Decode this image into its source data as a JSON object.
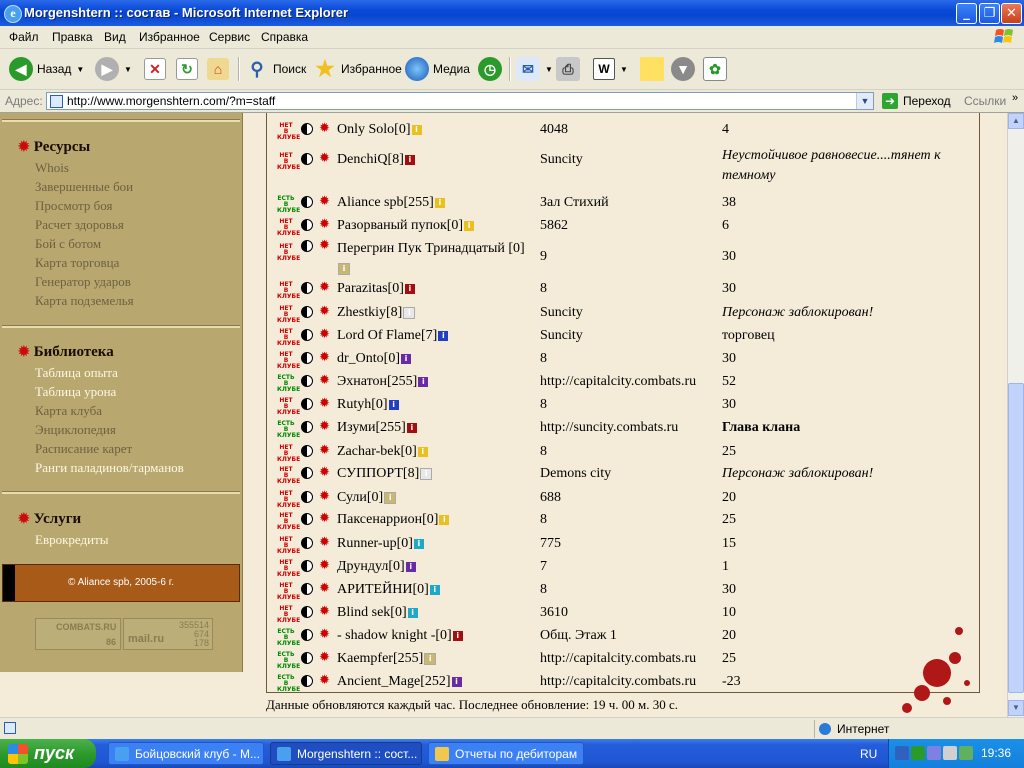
{
  "window": {
    "title": "Morgenshtern :: состав - Microsoft Internet Explorer"
  },
  "menu": [
    "Файл",
    "Правка",
    "Вид",
    "Избранное",
    "Сервис",
    "Справка"
  ],
  "toolbar": {
    "back": "Назад",
    "search": "Поиск",
    "favorites": "Избранное",
    "media": "Медиа"
  },
  "address": {
    "label": "Адрес:",
    "url": "http://www.morgenshtern.com/?m=staff",
    "go": "Переход",
    "links": "Ссылки"
  },
  "sidebar": {
    "resources_title": "Ресурсы",
    "resources": [
      "Whois",
      "Завершенные бои",
      "Просмотр боя",
      "Расчет здоровья",
      "Бой с ботом",
      "Карта торговца",
      "Генератор ударов",
      "Карта подземелья"
    ],
    "library_title": "Библиотека",
    "library": [
      "Таблица опыта",
      "Таблица урона",
      "Карта клуба",
      "Энциклопедия",
      "Расписание карет",
      "Ранги паладинов/тарманов"
    ],
    "services_title": "Услуги",
    "services": [
      "Еврокредиты"
    ],
    "copyright": "© Aliance spb, 2005-6 г.",
    "counters": {
      "combats": "COMBATS.RU",
      "combats_num": "86",
      "mail": "mail.ru",
      "mail_nums": [
        "355514",
        "674",
        "178"
      ]
    }
  },
  "status_labels": {
    "out": "НЕТ В КЛУБЕ",
    "in": "ЕСТЬ В КЛУБЕ"
  },
  "rows": [
    {
      "nick": "Only Solo[0]",
      "status": "out",
      "rank": "yellow",
      "city": "4048",
      "lvl": "4"
    },
    {
      "nick": "DenchiQ[8]",
      "status": "out",
      "rank": "darkred",
      "city": "Suncity",
      "lvl": "Неустойчивое равновесие....тянет к темному",
      "style": "it"
    },
    {
      "nick": "Aliance spb[255]",
      "status": "in",
      "rank": "yellow",
      "city": "Зал Стихий",
      "lvl": "38"
    },
    {
      "nick": "Разорваный пупок[0]",
      "status": "out",
      "rank": "yellow",
      "city": "5862",
      "lvl": "6"
    },
    {
      "nick": "Перегрин Пук Тринадцатый [0]",
      "status": "out",
      "rank": "khaki",
      "city": "9",
      "lvl": "30"
    },
    {
      "nick": "Parazitas[0]",
      "status": "out",
      "rank": "darkred",
      "city": "8",
      "lvl": "30"
    },
    {
      "nick": "Zhestkiy[8]",
      "status": "out",
      "rank": "white",
      "city": "Suncity",
      "lvl": "Персонаж заблокирован!",
      "style": "it"
    },
    {
      "nick": "Lord Of Flame[7]",
      "status": "out",
      "rank": "blue",
      "city": "Suncity",
      "lvl": "торговец"
    },
    {
      "nick": "dr_Onto[0]",
      "status": "out",
      "rank": "purple",
      "city": "8",
      "lvl": "30"
    },
    {
      "nick": "Эхнатон[255]",
      "status": "in",
      "rank": "purple",
      "city": "http://capitalcity.combats.ru",
      "lvl": "52"
    },
    {
      "nick": "Rutyh[0]",
      "status": "out",
      "rank": "blue",
      "city": "8",
      "lvl": "30"
    },
    {
      "nick": "Изуми[255]",
      "status": "in",
      "rank": "darkred",
      "city": "http://suncity.combats.ru",
      "lvl": "Глава клана",
      "style": "bold"
    },
    {
      "nick": "Zachar-bek[0]",
      "status": "out",
      "rank": "yellow",
      "city": "8",
      "lvl": "25"
    },
    {
      "nick": "СУППОРТ[8]",
      "status": "out",
      "rank": "white",
      "city": "Demons city",
      "lvl": "Персонаж заблокирован!",
      "style": "it"
    },
    {
      "nick": "Сули[0]",
      "status": "out",
      "rank": "khaki",
      "city": "688",
      "lvl": "20"
    },
    {
      "nick": "Паксенаррион[0]",
      "status": "out",
      "rank": "yellow",
      "city": "8",
      "lvl": "25"
    },
    {
      "nick": "Runner-up[0]",
      "status": "out",
      "rank": "cyan",
      "city": "775",
      "lvl": "15"
    },
    {
      "nick": "Друндул[0]",
      "status": "out",
      "rank": "purple",
      "city": "7",
      "lvl": "1"
    },
    {
      "nick": "АРИТЕЙНИ[0]",
      "status": "out",
      "rank": "cyan",
      "city": "8",
      "lvl": "30"
    },
    {
      "nick": "Blind sek[0]",
      "status": "out",
      "rank": "cyan",
      "city": "3610",
      "lvl": "10"
    },
    {
      "nick": "- shadow knight -[0]",
      "status": "in",
      "rank": "darkred",
      "city": "Общ. Этаж 1",
      "lvl": "20"
    },
    {
      "nick": "Kaempfer[255]",
      "status": "in",
      "rank": "khaki",
      "city": "http://capitalcity.combats.ru",
      "lvl": "25"
    },
    {
      "nick": "Ancient_Mage[252]",
      "status": "in",
      "rank": "purple",
      "city": "http://capitalcity.combats.ru",
      "lvl": "-23"
    }
  ],
  "rank_colors": {
    "yellow": "#e8c020",
    "darkred": "#a01010",
    "khaki": "#c8b870",
    "white": "#e8e8e8",
    "blue": "#2040c0",
    "purple": "#6a2aa8",
    "cyan": "#20a8c8"
  },
  "footnote": "Данные обновляются каждый час. Последнее обновление: 19 ч. 00 м. 30 с.",
  "statusbar": {
    "zone": "Интернет"
  },
  "taskbar": {
    "start": "пуск",
    "tasks": [
      "Бойцовский клуб - М...",
      "Morgenshtern :: сост...",
      "Отчеты по дебиторам"
    ],
    "lang": "RU",
    "clock": "19:36"
  }
}
